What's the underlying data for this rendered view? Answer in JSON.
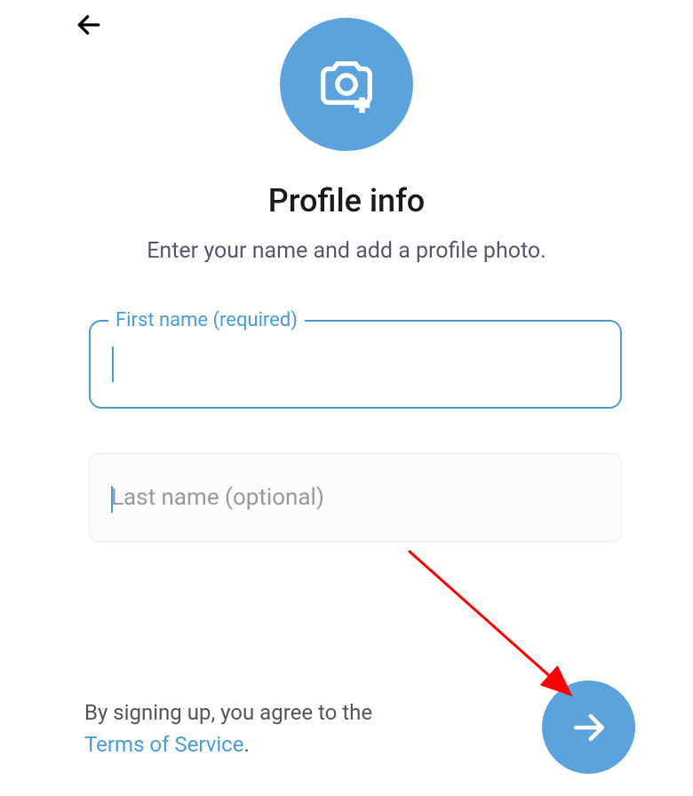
{
  "heading": "Profile info",
  "subheading": "Enter your name and add a profile photo.",
  "fields": {
    "first_name": {
      "label": "First name (required)",
      "value": ""
    },
    "last_name": {
      "placeholder": "Last name (optional)",
      "value": ""
    }
  },
  "terms": {
    "prefix": "By signing up, you agree to the ",
    "link": "Terms of Service",
    "suffix": "."
  },
  "colors": {
    "accent": "#5aa3dd",
    "outline": "#4a9cd6"
  }
}
